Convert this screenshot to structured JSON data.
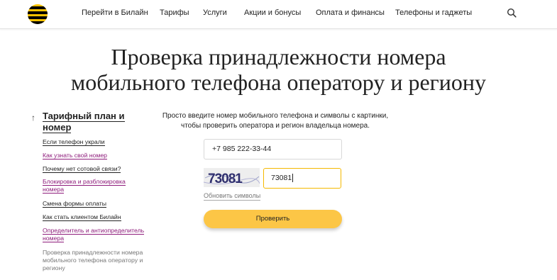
{
  "header": {
    "nav": [
      "Перейти в Билайн",
      "Тарифы",
      "Услуги",
      "Акции и бонусы",
      "Оплата и финансы",
      "Телефоны и гаджеты"
    ],
    "brand_color": "#fec200",
    "icons": {
      "logo": "beeline-logo",
      "search": "search-icon"
    }
  },
  "page": {
    "title_line1": "Проверка принадлежности номера",
    "title_line2": "мобильного телефона оператору и региону"
  },
  "sidebar": {
    "heading_line1": "Тарифный план и",
    "heading_line2": "номер",
    "items": [
      {
        "lines": [
          "Если телефон украли"
        ]
      },
      {
        "lines": [
          "Как узнать свой номер"
        ]
      },
      {
        "lines": [
          "Почему нет сотовой связи?"
        ]
      },
      {
        "lines": [
          "Блокировка и разблокировка",
          "номера"
        ]
      },
      {
        "lines": [
          "Смена формы оплаты"
        ]
      },
      {
        "lines": [
          "Как стать клиентом Билайн"
        ]
      },
      {
        "lines": [
          "Определитель и антиопределитель",
          "номера"
        ]
      },
      {
        "lines": [
          "Проверка принадлежности номера",
          "мобильного телефона оператору и",
          "региону"
        ]
      }
    ]
  },
  "form": {
    "intro_line1": "Просто введите номер мобильного телефона и символы с картинки,",
    "intro_line2": "чтобы проверить оператора и регион владельца номера.",
    "phone_value": "+7 985 222-33-44",
    "captcha_image_text": "73081",
    "captcha_value": "73081",
    "refresh_label": "Обновить символы",
    "submit_label": "Проверить",
    "accent_color": "#f5b800",
    "button_color": "#fcc646"
  }
}
